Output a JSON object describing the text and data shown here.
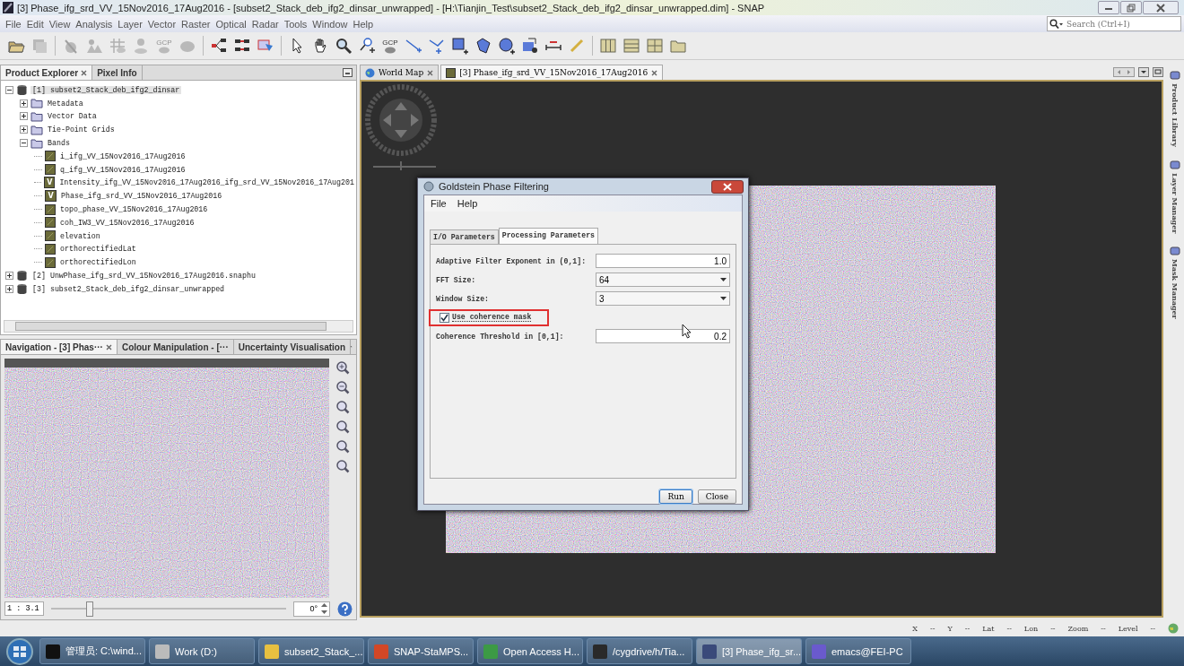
{
  "window": {
    "title": "[3] Phase_ifg_srd_VV_15Nov2016_17Aug2016 - [subset2_Stack_deb_ifg2_dinsar_unwrapped] - [H:\\Tianjin_Test\\subset2_Stack_deb_ifg2_dinsar_unwrapped.dim] - SNAP"
  },
  "menu": [
    "File",
    "Edit",
    "View",
    "Analysis",
    "Layer",
    "Vector",
    "Raster",
    "Optical",
    "Radar",
    "Tools",
    "Window",
    "Help"
  ],
  "search": {
    "placeholder": "Search (Ctrl+I)"
  },
  "toolbar": [
    {
      "kind": "open",
      "disabled": false
    },
    {
      "kind": "save",
      "disabled": true
    },
    {
      "kind": "sep"
    },
    {
      "kind": "split",
      "disabled": true
    },
    {
      "kind": "people",
      "disabled": true
    },
    {
      "kind": "grid",
      "disabled": true
    },
    {
      "kind": "person",
      "disabled": true
    },
    {
      "kind": "gcp",
      "label": "GCP",
      "disabled": true
    },
    {
      "kind": "blob",
      "disabled": true
    },
    {
      "kind": "sep"
    },
    {
      "kind": "graph",
      "disabled": false
    },
    {
      "kind": "batch",
      "disabled": false
    },
    {
      "kind": "map",
      "disabled": false
    },
    {
      "kind": "sep"
    },
    {
      "kind": "select",
      "disabled": false
    },
    {
      "kind": "pan",
      "disabled": false
    },
    {
      "kind": "zoom",
      "disabled": false
    },
    {
      "kind": "pin",
      "disabled": false
    },
    {
      "kind": "gcp",
      "label": "GCP",
      "disabled": false
    },
    {
      "kind": "line",
      "disabled": false
    },
    {
      "kind": "polyline",
      "disabled": false
    },
    {
      "kind": "rect",
      "disabled": false
    },
    {
      "kind": "polygon",
      "disabled": false
    },
    {
      "kind": "ellipse",
      "disabled": false
    },
    {
      "kind": "vertex",
      "disabled": false
    },
    {
      "kind": "range",
      "disabled": false
    },
    {
      "kind": "wand",
      "disabled": false
    },
    {
      "kind": "sep"
    },
    {
      "kind": "tile_v",
      "disabled": false
    },
    {
      "kind": "tile_h",
      "disabled": false
    },
    {
      "kind": "tile_grid",
      "disabled": false
    },
    {
      "kind": "folder",
      "disabled": false
    }
  ],
  "explorer": {
    "tabs": [
      {
        "label": "Product Explorer",
        "selected": true
      },
      {
        "label": "Pixel Info",
        "selected": false
      }
    ],
    "tree": [
      {
        "kind": "product",
        "label": "[1] subset2_Stack_deb_ifg2_dinsar",
        "expanded": true,
        "selected": true,
        "children": [
          {
            "kind": "folder",
            "label": "Metadata",
            "expanded": false,
            "selected": false
          },
          {
            "kind": "folder",
            "label": "Vector Data",
            "expanded": false,
            "selected": false
          },
          {
            "kind": "folder",
            "label": "Tie-Point Grids",
            "expanded": false,
            "selected": false
          },
          {
            "kind": "folder",
            "label": "Bands",
            "expanded": true,
            "selected": false,
            "children": [
              {
                "kind": "band",
                "label": "i_ifg_VV_15Nov2016_17Aug2016",
                "selected": false
              },
              {
                "kind": "band",
                "label": "q_ifg_VV_15Nov2016_17Aug2016",
                "selected": false
              },
              {
                "kind": "virtual_band",
                "icon_label": "V",
                "label": "Intensity_ifg_VV_15Nov2016_17Aug2016_ifg_srd_VV_15Nov2016_17Aug201",
                "selected": false
              },
              {
                "kind": "virtual_band",
                "icon_label": "V",
                "label": "Phase_ifg_srd_VV_15Nov2016_17Aug2016",
                "selected": false
              },
              {
                "kind": "band",
                "label": "topo_phase_VV_15Nov2016_17Aug2016",
                "selected": false
              },
              {
                "kind": "band",
                "label": "coh_IW3_VV_15Nov2016_17Aug2016",
                "selected": false
              },
              {
                "kind": "band",
                "label": "elevation",
                "selected": false
              },
              {
                "kind": "band",
                "label": "orthorectifiedLat",
                "selected": false
              },
              {
                "kind": "band",
                "label": "orthorectifiedLon",
                "selected": false
              }
            ]
          }
        ]
      },
      {
        "kind": "product",
        "label": "[2] UnwPhase_ifg_srd_VV_15Nov2016_17Aug2016.snaphu",
        "expanded": false,
        "selected": false
      },
      {
        "kind": "product",
        "label": "[3] subset2_Stack_deb_ifg2_dinsar_unwrapped",
        "expanded": false,
        "selected": false
      }
    ]
  },
  "navigation": {
    "tabs": [
      {
        "label": "Navigation - [3] Phas···",
        "selected": true
      },
      {
        "label": "Colour Manipulation - [···",
        "selected": false
      },
      {
        "label": "Uncertainty Visualisation",
        "selected": false
      }
    ],
    "scale": "1 : 3.1",
    "level": 0.16,
    "angle": "0°"
  },
  "editor_tabs": [
    {
      "kind": "world_map",
      "label": "World Map",
      "selected": false
    },
    {
      "kind": "band",
      "label": "[3] Phase_ifg_srd_VV_15Nov2016_17Aug2016",
      "selected": true
    }
  ],
  "side_panels": [
    "Product Library",
    "Layer Manager",
    "Mask Manager"
  ],
  "dialog": {
    "title": "Goldstein Phase Filtering",
    "menu": [
      "File",
      "Help"
    ],
    "tabs": [
      {
        "label": "I/O Parameters",
        "selected": false
      },
      {
        "label": "Processing Parameters",
        "selected": true
      }
    ],
    "params": [
      {
        "kind": "text",
        "label": "Adaptive Filter Exponent in (0,1]:",
        "value": "1.0"
      },
      {
        "kind": "dropdown",
        "label": "FFT Size:",
        "value": "64"
      },
      {
        "kind": "dropdown",
        "label": "Window Size:",
        "value": "3"
      },
      {
        "kind": "checkbox",
        "label": "Use coherence mask",
        "checked": true,
        "highlighted": true
      },
      {
        "kind": "text",
        "label": "Coherence Threshold in [0,1]:",
        "value": "0.2"
      }
    ],
    "buttons": [
      {
        "label": "Run",
        "focused": true
      },
      {
        "label": "Close",
        "focused": false
      }
    ]
  },
  "status_bar": [
    {
      "label": "X",
      "value": "--"
    },
    {
      "label": "Y",
      "value": "--"
    },
    {
      "label": "Lat",
      "value": "--"
    },
    {
      "label": "Lon",
      "value": "--"
    },
    {
      "label": "Zoom",
      "value": "--"
    },
    {
      "label": "Level",
      "value": "--"
    }
  ],
  "taskbar": [
    {
      "kind": "cmd",
      "label": "管理员: C:\\wind...",
      "selected": false
    },
    {
      "kind": "drive",
      "label": "Work (D:)",
      "selected": false
    },
    {
      "kind": "explorer",
      "label": "subset2_Stack_...",
      "selected": false
    },
    {
      "kind": "powerpoint",
      "label": "SNAP-StaMPS...",
      "selected": false
    },
    {
      "kind": "chrome",
      "label": "Open Access H...",
      "selected": false
    },
    {
      "kind": "terminal",
      "label": "/cygdrive/h/Tia...",
      "selected": false
    },
    {
      "kind": "snap",
      "label": "[3] Phase_ifg_sr...",
      "selected": true
    },
    {
      "kind": "emacs",
      "label": "emacs@FEI-PC",
      "selected": false
    }
  ]
}
